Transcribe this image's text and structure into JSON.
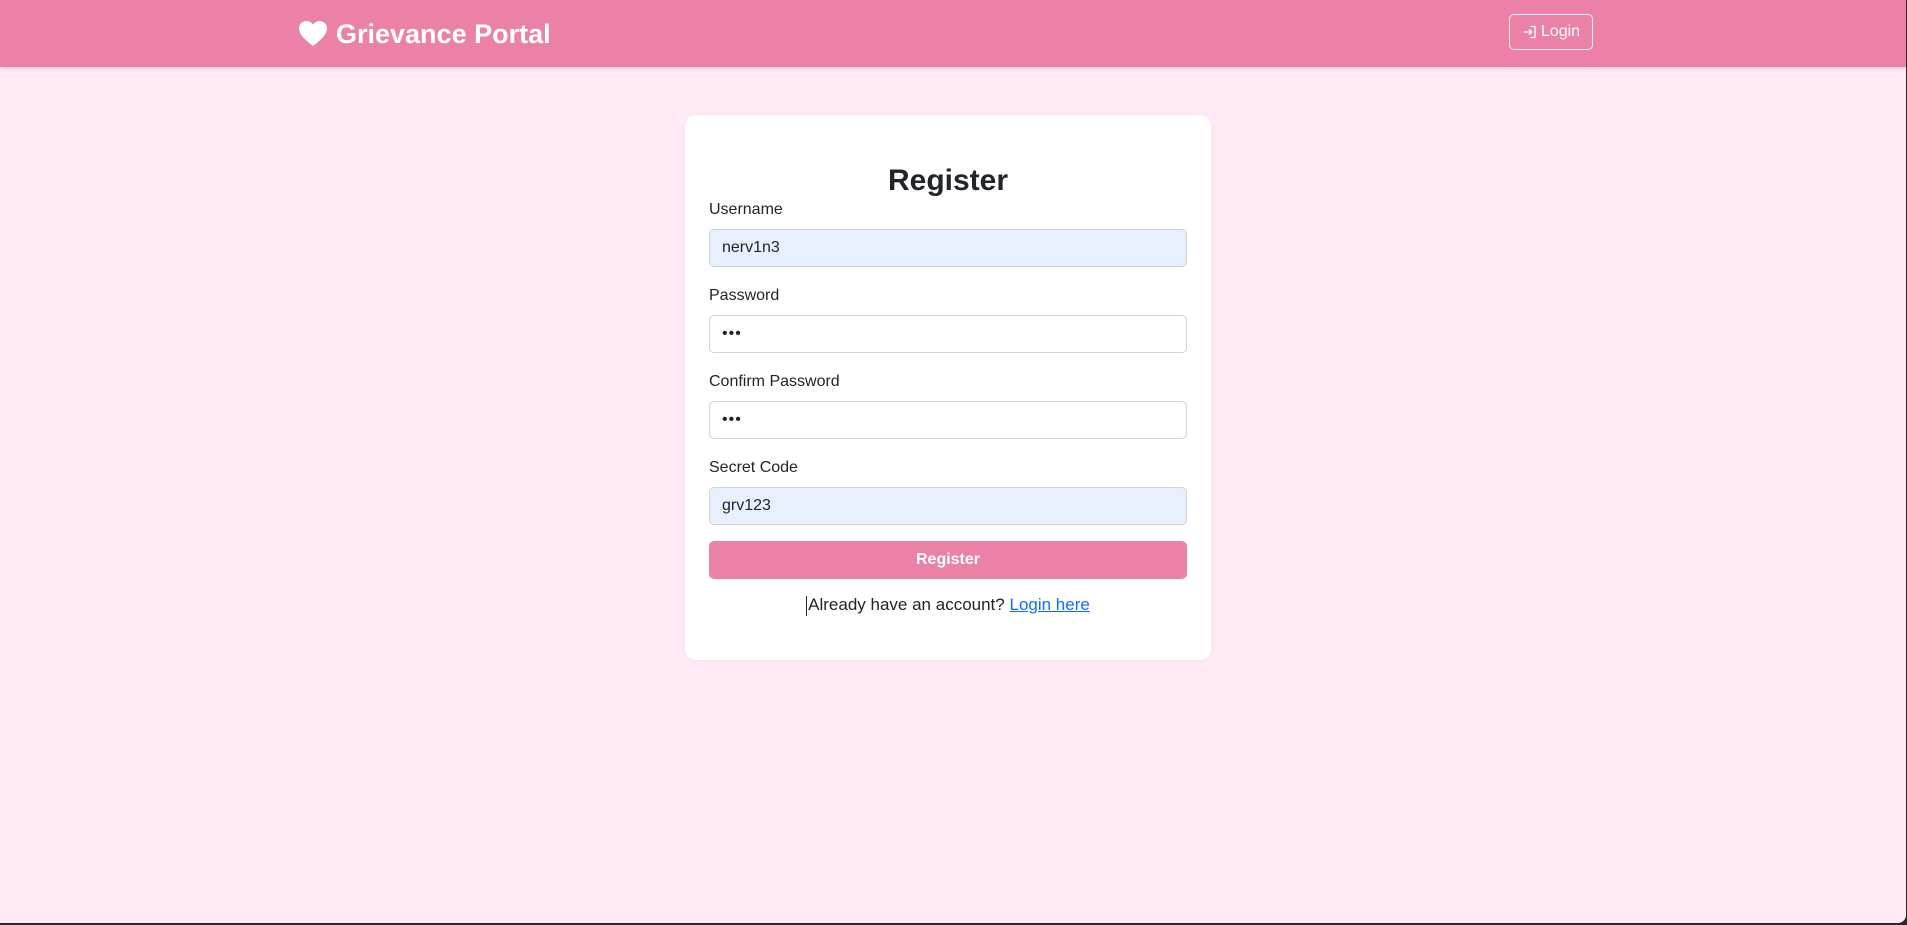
{
  "navbar": {
    "brand": "Grievance Portal",
    "brand_icon": "heart-icon",
    "login_label": "Login",
    "login_icon": "login-arrow-icon"
  },
  "form": {
    "title": "Register",
    "username": {
      "label": "Username",
      "value": "nerv1n3"
    },
    "password": {
      "label": "Password",
      "value": "•••"
    },
    "confirm_password": {
      "label": "Confirm Password",
      "value": "•••"
    },
    "secret_code": {
      "label": "Secret Code",
      "value": "grv123"
    },
    "submit_label": "Register"
  },
  "footer": {
    "prompt": "Already have an account?",
    "link": "Login here"
  },
  "colors": {
    "accent": "#ec81a8",
    "page_background": "#ffeaf6",
    "card_background": "#ffffff",
    "autofill_background": "#e8f0fe",
    "link": "#0d6efd"
  }
}
